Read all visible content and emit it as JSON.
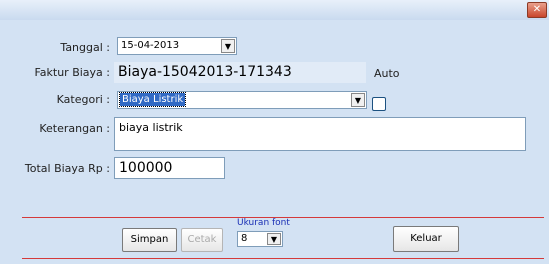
{
  "window": {
    "close_glyph": "✕"
  },
  "form": {
    "tanggal_label": "Tanggal :",
    "tanggal_value": "15-04-2013",
    "faktur_label": "Faktur Biaya :",
    "faktur_value": "Biaya-15042013-171343",
    "auto_label": "Auto",
    "kategori_label": "Kategori :",
    "kategori_value": "Biaya Listrik",
    "keterangan_label": "Keterangan :",
    "keterangan_value": "biaya listrik",
    "total_label": "Total Biaya Rp :",
    "total_value": "100000"
  },
  "footer": {
    "simpan_label": "Simpan",
    "cetak_label": "Cetak",
    "font_label": "Ukuran font",
    "font_value": "8",
    "keluar_label": "Keluar"
  },
  "icons": {
    "dropdown": "chevron-down-icon",
    "close": "close-icon"
  },
  "colors": {
    "selection": "#316ac5",
    "accent_line": "#d43a3a",
    "font_label": "#1a2fb5"
  }
}
